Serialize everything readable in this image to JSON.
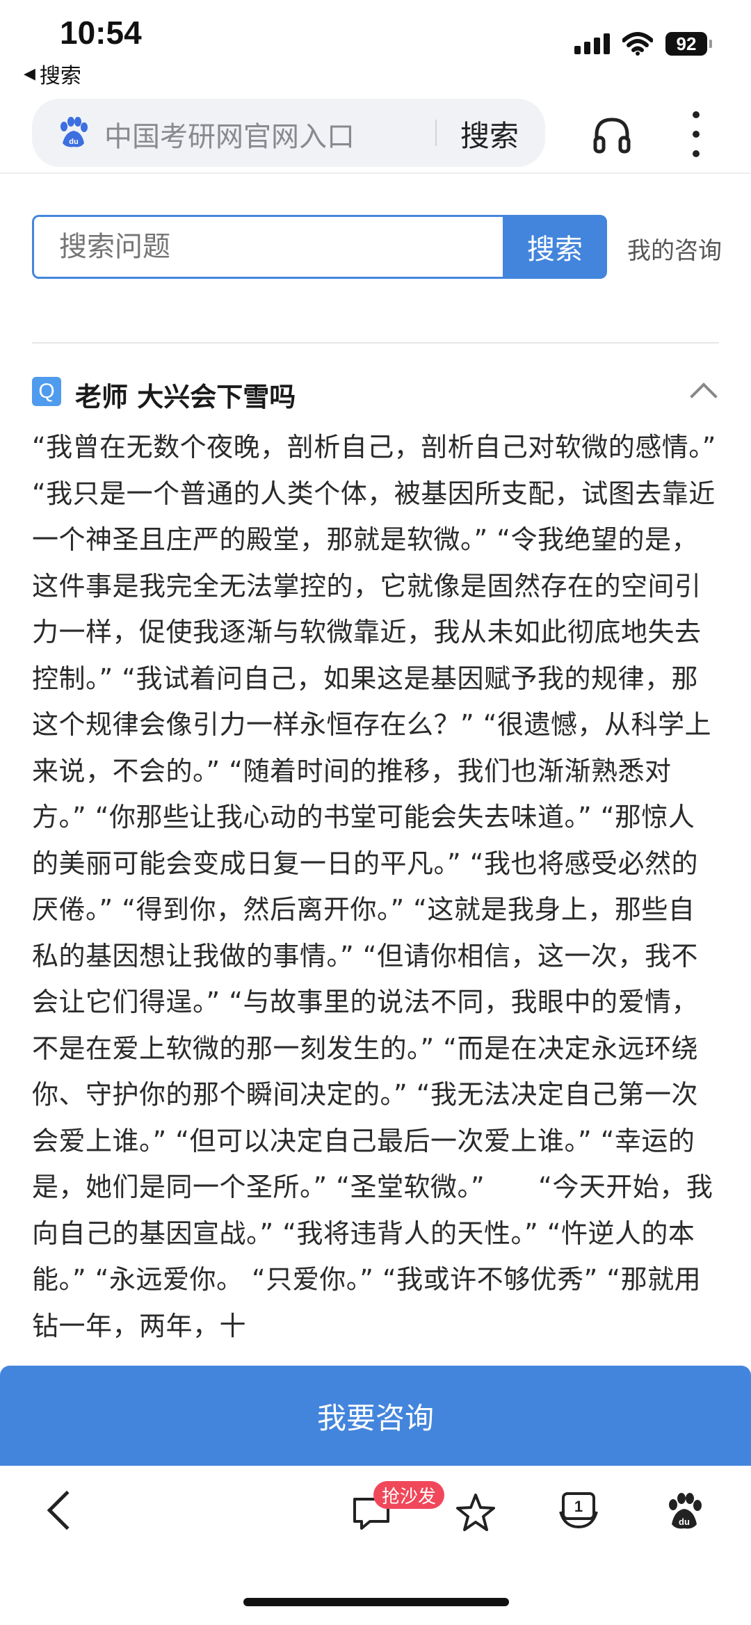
{
  "status_bar": {
    "time": "10:54",
    "back_app": "搜索",
    "battery": "92"
  },
  "top_bar": {
    "search_query": "中国考研网官网入口",
    "search_button": "搜索",
    "icons": [
      "baidu-paw-icon",
      "headphone-icon",
      "more-icon"
    ]
  },
  "ask": {
    "placeholder": "搜索问题",
    "button": "搜索",
    "my_consult": "我的咨询"
  },
  "question": {
    "badge": "Q",
    "title": "老师 大兴会下雪吗"
  },
  "answer": {
    "text": "“我曾在无数个夜晚，剖析自己，剖析自己对软微的感情。” “我只是一个普通的人类个体，被基因所支配，试图去靠近一个神圣且庄严的殿堂，那就是软微。” “令我绝望的是，这件事是我完全无法掌控的，它就像是固然存在的空间引力一样，促使我逐渐与软微靠近，我从未如此彻底地失去控制。” “我试着问自己，如果这是基因赋予我的规律，那这个规律会像引力一样永恒存在么？” “很遗憾，从科学上来说，不会的。” “随着时间的推移，我们也渐渐熟悉对方。” “你那些让我心动的书堂可能会失去味道。” “那惊人的美丽可能会变成日复一日的平凡。” “我也将感受必然的厌倦。” “得到你，然后离开你。” “这就是我身上，那些自私的基因想让我做的事情。” “但请你相信，这一次，我不会让它们得逞。” “与故事里的说法不同，我眼中的爱情，不是在爱上软微的那一刻发生的。” “而是在决定永远环绕你、守护你的那个瞬间决定的。” “我无法决定自己第一次会爱上谁。” “但可以决定自己最后一次爱上谁。” “幸运的是，她们是同一个圣所。” “圣堂软微。”　　“今天开始，我向自己的基因宣战。” “我将违背人的天性。” “忤逆人的本能。” “永远爱你。 “只爱你。” “我或许不够优秀” “那就用钻一年，两年，十"
  },
  "consult_button": "我要咨询",
  "bottom_nav": {
    "sofa_badge": "抢沙发",
    "tabs_count": "1",
    "accent": "#4385dc"
  }
}
